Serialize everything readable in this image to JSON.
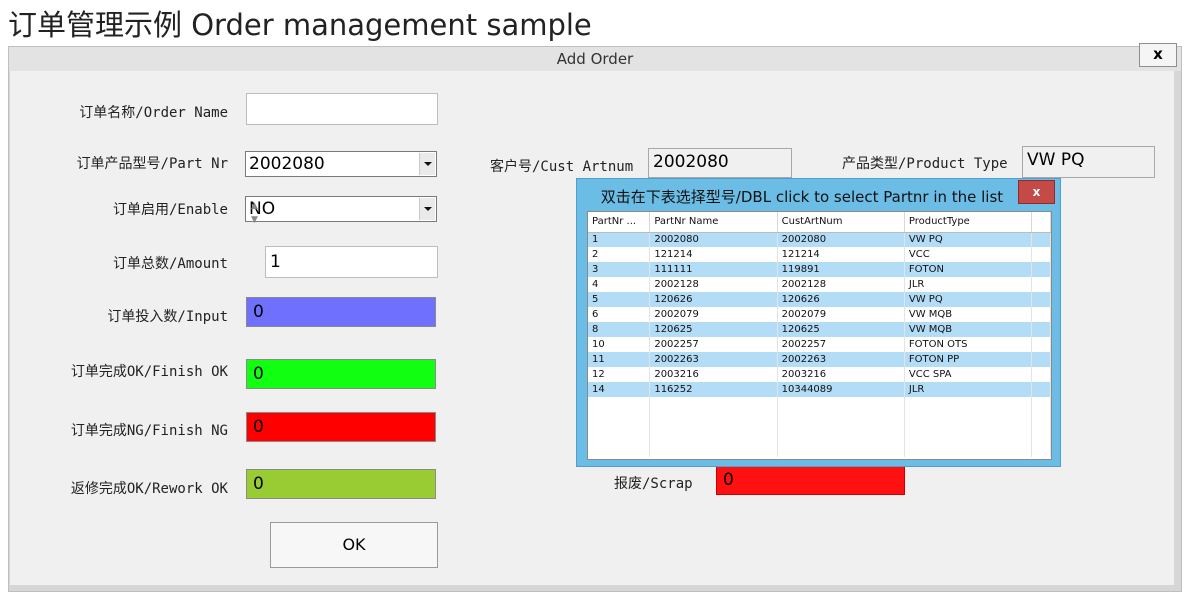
{
  "page_title": "订单管理示例  Order management sample",
  "window": {
    "title": "Add Order",
    "close_label": "x"
  },
  "form": {
    "order_name": {
      "label": "订单名称/Order Name",
      "value": ""
    },
    "part_nr": {
      "label": "订单产品型号/Part Nr",
      "value": "2002080"
    },
    "enable": {
      "label": "订单启用/Enable",
      "value": "NO"
    },
    "amount": {
      "label": "订单总数/Amount",
      "value": "1"
    },
    "input": {
      "label": "订单投入数/Input",
      "value": "0"
    },
    "finish_ok": {
      "label": "订单完成OK/Finish OK",
      "value": "0"
    },
    "finish_ng": {
      "label": "订单完成NG/Finish NG",
      "value": "0"
    },
    "rework_ok": {
      "label": "返修完成OK/Rework OK",
      "value": "0"
    },
    "cust_artnum": {
      "label": "客户号/Cust Artnum",
      "value": "2002080"
    },
    "product_type": {
      "label": "产品类型/Product Type",
      "value": "VW PQ"
    },
    "scrap": {
      "label": "报废/Scrap",
      "value": "0"
    },
    "ok_label": "OK"
  },
  "colors": {
    "input_box": "#7070ff",
    "finish_ok_box": "#11ff11",
    "finish_ng_box": "#ff0000",
    "rework_ok_box": "#99cc33",
    "scrap_box": "#ff1111",
    "selected_row": "#b3dcf7",
    "popup_frame": "#6bbde6"
  },
  "popup": {
    "title": "双击在下表选择型号/DBL click to select Partnr in the list",
    "close_label": "x",
    "columns": [
      "PartNr ...",
      "PartNr Name",
      "CustArtNum",
      "ProductType"
    ],
    "rows": [
      {
        "cells": [
          "1",
          "2002080",
          "2002080",
          "VW PQ"
        ],
        "selected": true
      },
      {
        "cells": [
          "2",
          "121214",
          "121214",
          "VCC"
        ],
        "selected": false
      },
      {
        "cells": [
          "3",
          "111111",
          "119891",
          "FOTON"
        ],
        "selected": true
      },
      {
        "cells": [
          "4",
          "2002128",
          "2002128",
          "JLR"
        ],
        "selected": false
      },
      {
        "cells": [
          "5",
          "120626",
          "120626",
          "VW PQ"
        ],
        "selected": true
      },
      {
        "cells": [
          "6",
          "2002079",
          "2002079",
          "VW MQB"
        ],
        "selected": false
      },
      {
        "cells": [
          "8",
          "120625",
          "120625",
          "VW MQB"
        ],
        "selected": true
      },
      {
        "cells": [
          "10",
          "2002257",
          "2002257",
          "FOTON OTS"
        ],
        "selected": false
      },
      {
        "cells": [
          "11",
          "2002263",
          "2002263",
          "FOTON PP"
        ],
        "selected": true
      },
      {
        "cells": [
          "12",
          "2003216",
          "2003216",
          "VCC SPA"
        ],
        "selected": false
      },
      {
        "cells": [
          "14",
          "116252",
          "10344089",
          "JLR"
        ],
        "selected": true
      }
    ]
  }
}
